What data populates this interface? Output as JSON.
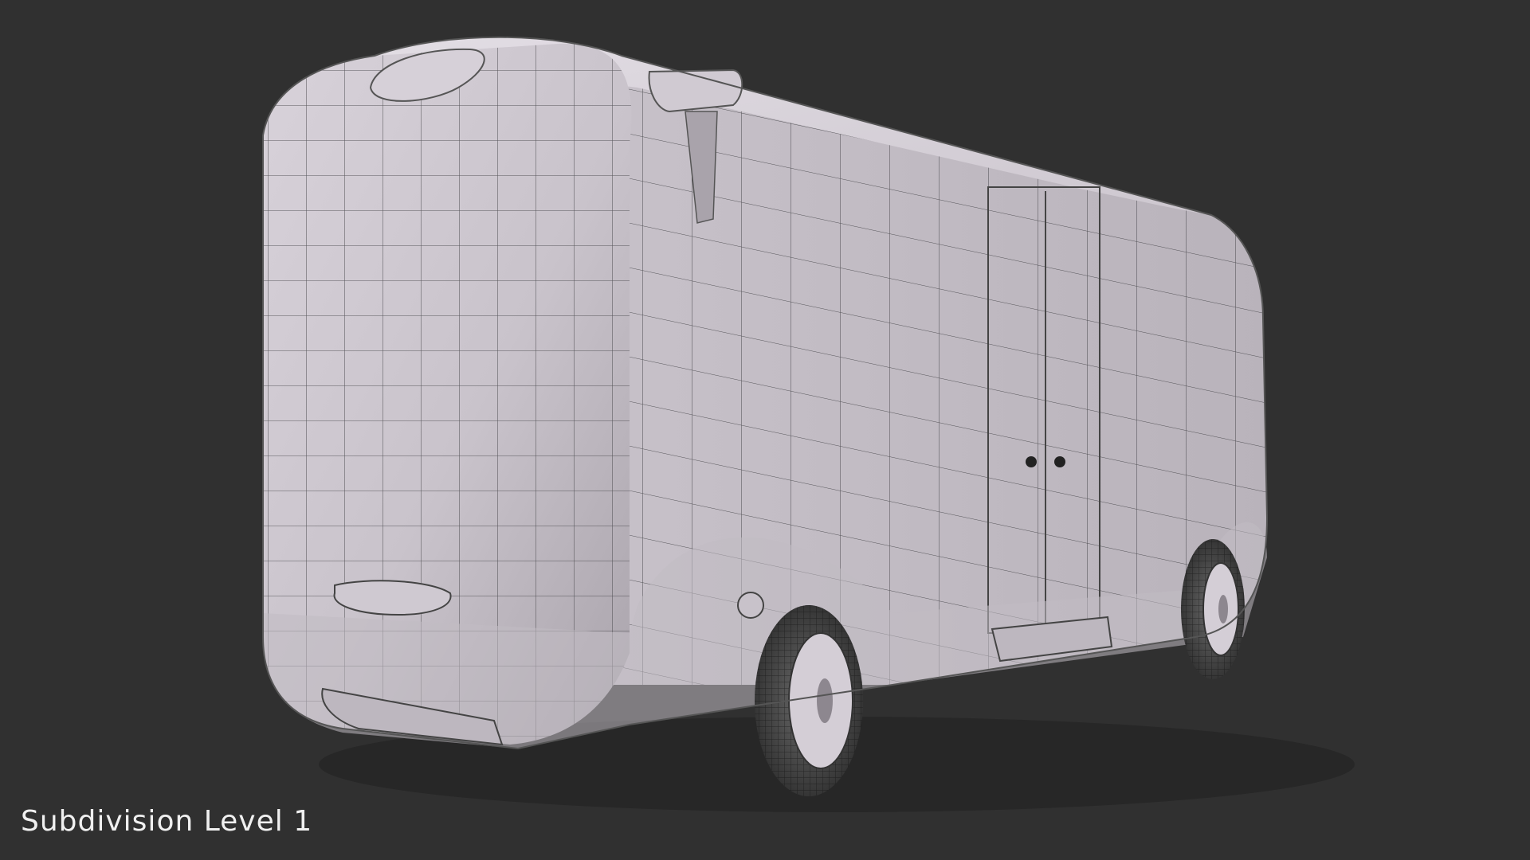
{
  "scene": {
    "subject": "vehicle-wireframe-render",
    "background_color": "#303030",
    "body_color": "#cfc9d0",
    "wire_color": "#3a3a3a"
  },
  "caption": {
    "text": "Subdivision Level 1"
  }
}
